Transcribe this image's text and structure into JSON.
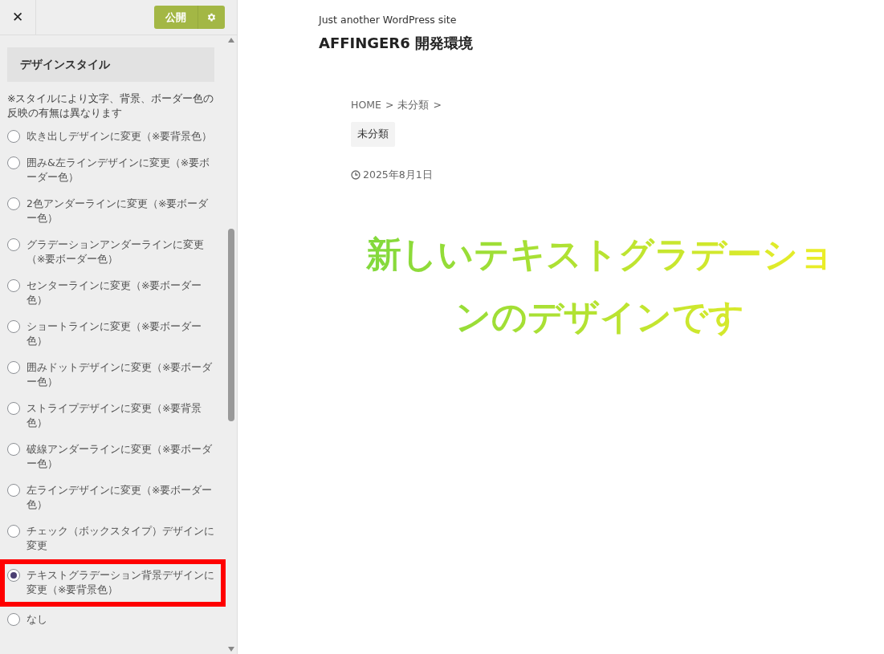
{
  "sidebar": {
    "close": "✕",
    "publish": "公開",
    "section_title": "デザインスタイル",
    "note": "※スタイルにより文字、背景、ボーダー色の反映の有無は異なります",
    "options": [
      {
        "label": "吹き出しデザインに変更（※要背景色）",
        "selected": false,
        "highlighted": false
      },
      {
        "label": "囲み&左ラインデザインに変更（※要ボーダー色）",
        "selected": false,
        "highlighted": false
      },
      {
        "label": "2色アンダーラインに変更（※要ボーダー色）",
        "selected": false,
        "highlighted": false
      },
      {
        "label": "グラデーションアンダーラインに変更（※要ボーダー色）",
        "selected": false,
        "highlighted": false
      },
      {
        "label": "センターラインに変更（※要ボーダー色）",
        "selected": false,
        "highlighted": false
      },
      {
        "label": "ショートラインに変更（※要ボーダー色）",
        "selected": false,
        "highlighted": false
      },
      {
        "label": "囲みドットデザインに変更（※要ボーダー色）",
        "selected": false,
        "highlighted": false
      },
      {
        "label": "ストライプデザインに変更（※要背景色）",
        "selected": false,
        "highlighted": false
      },
      {
        "label": "破線アンダーラインに変更（※要ボーダー色）",
        "selected": false,
        "highlighted": false
      },
      {
        "label": "左ラインデザインに変更（※要ボーダー色）",
        "selected": false,
        "highlighted": false
      },
      {
        "label": "チェック（ボックスタイプ）デザインに変更",
        "selected": false,
        "highlighted": false
      },
      {
        "label": "テキストグラデーション背景デザインに変更（※要背景色）",
        "selected": true,
        "highlighted": true
      },
      {
        "label": "なし",
        "selected": false,
        "highlighted": false
      }
    ]
  },
  "preview": {
    "tagline": "Just another WordPress site",
    "site_title": "AFFINGER6 開発環境",
    "breadcrumb": [
      {
        "label": "HOME"
      },
      {
        "label": "未分類"
      }
    ],
    "separator": ">",
    "category": "未分類",
    "date": "2025年8月1日",
    "heading": "新しいテキストグラデーションのデザインです"
  }
}
